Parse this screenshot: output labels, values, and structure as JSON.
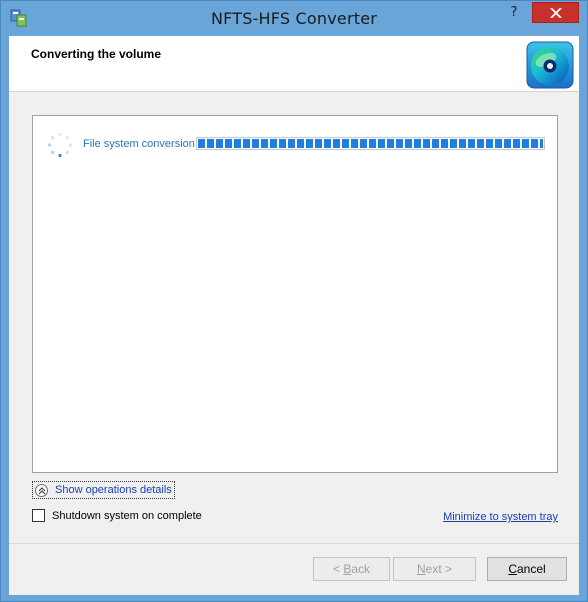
{
  "window": {
    "title": "NFTS-HFS Converter",
    "help_glyph": "?"
  },
  "header": {
    "title": "Converting the volume"
  },
  "operations": [
    {
      "label": "File system conversion",
      "progress_percent": 100
    }
  ],
  "details": {
    "label": "Show operations details"
  },
  "options": {
    "shutdown_label": "Shutdown system on complete",
    "shutdown_checked": false,
    "tray_link": "Minimize to system tray"
  },
  "buttons": {
    "back_mnemonic": "B",
    "back_rest": "ack",
    "back_prefix": "< ",
    "next_mnemonic": "N",
    "next_rest": "ext >",
    "cancel_mnemonic": "C",
    "cancel_rest": "ancel"
  },
  "colors": {
    "accent": "#1f7fe0",
    "link": "#1c3fb5",
    "op_label": "#2a75b9",
    "close": "#c7312b"
  },
  "icons": {
    "app": "app-icon",
    "help": "help-icon",
    "close": "close-icon",
    "disc": "disc-icon",
    "spinner": "spinner-icon",
    "expand": "chevron-up-icon"
  }
}
